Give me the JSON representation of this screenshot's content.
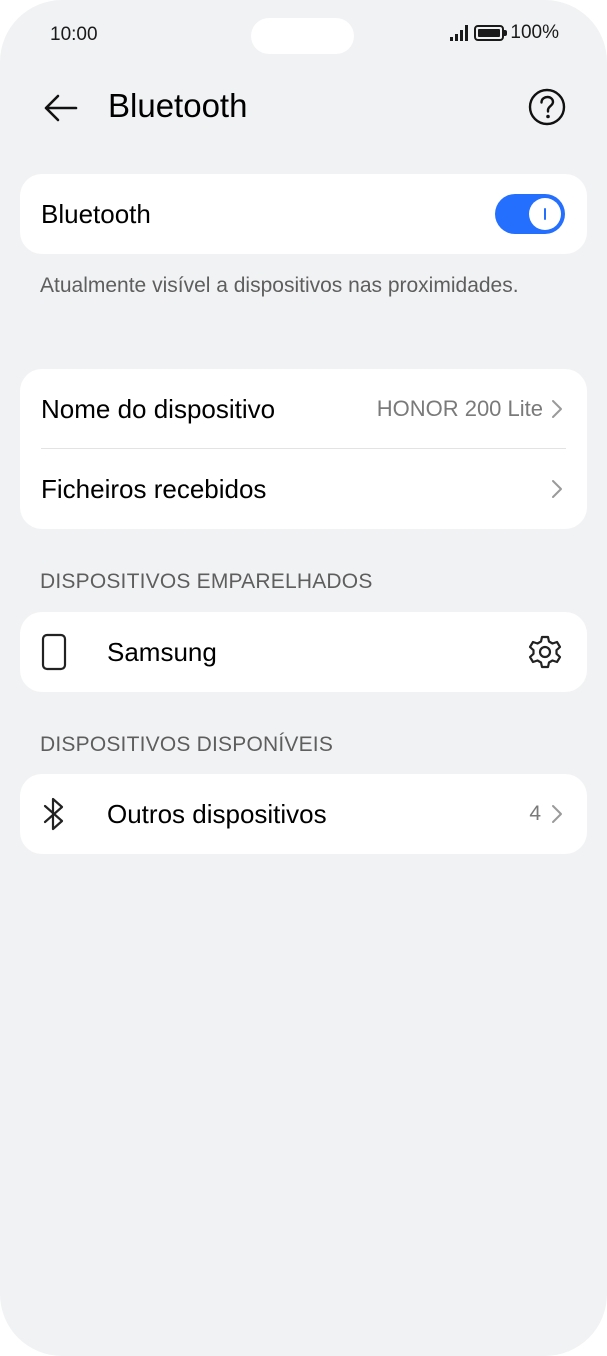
{
  "status_bar": {
    "time": "10:00",
    "battery": "100%"
  },
  "header": {
    "title": "Bluetooth",
    "back_icon": "arrow-left-icon",
    "help_icon": "question-circle-icon"
  },
  "bluetooth_card": {
    "label": "Bluetooth",
    "enabled": true,
    "accent_color": "#256fff"
  },
  "visibility_caption": "Atualmente visível a dispositivos nas proximidades.",
  "device_card": {
    "name_label": "Nome do dispositivo",
    "name_value": "HONOR 200 Lite",
    "received_label": "Ficheiros recebidos"
  },
  "paired_section": {
    "title": "DISPOSITIVOS EMPARELHADOS",
    "devices": [
      {
        "name": "Samsung",
        "icon": "phone-icon",
        "action_icon": "gear-icon"
      }
    ]
  },
  "available_section": {
    "title": "DISPOSITIVOS DISPONÍVEIS",
    "other_label": "Outros dispositivos",
    "other_count": "4",
    "icon": "bluetooth-icon"
  }
}
